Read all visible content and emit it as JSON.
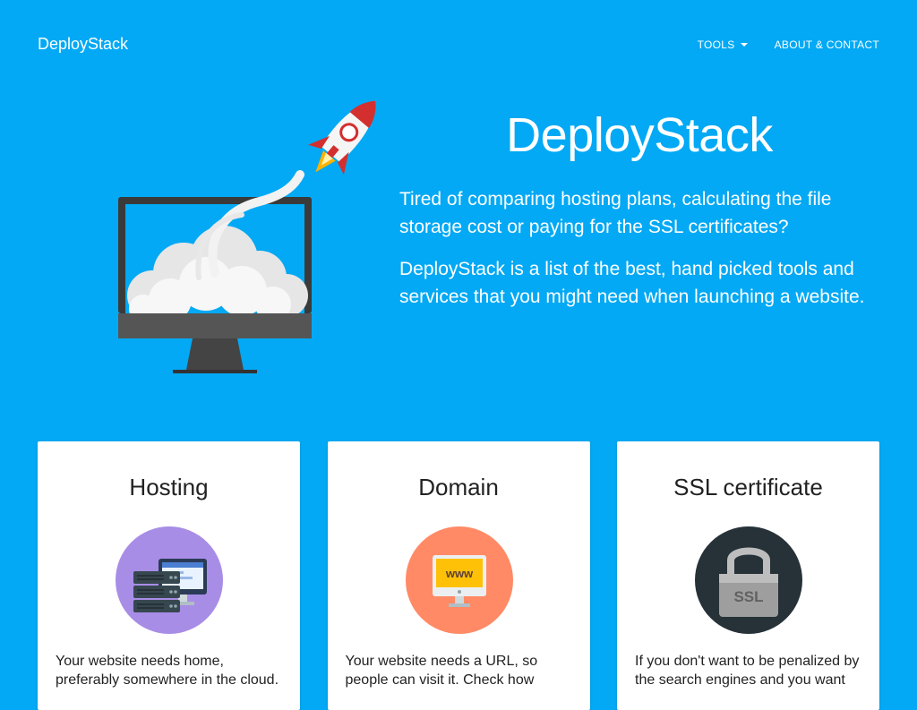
{
  "nav": {
    "brand": "DeployStack",
    "tools": "TOOLS",
    "about": "ABOUT & CONTACT"
  },
  "hero": {
    "title": "DeployStack",
    "p1": "Tired of comparing hosting plans, calculating the file storage cost or paying for the SSL certificates?",
    "p2": "DeployStack is a list of the best, hand picked tools and services that you might need when launching a website."
  },
  "cards": [
    {
      "title": "Hosting",
      "icon": "server-icon",
      "color": "#a88de6",
      "text": "Your website needs home, preferably somewhere in the cloud."
    },
    {
      "title": "Domain",
      "icon": "www-monitor-icon",
      "color": "#ff8a65",
      "text": "Your website needs a URL, so people can visit it. Check how"
    },
    {
      "title": "SSL certificate",
      "icon": "ssl-lock-icon",
      "color": "#263238",
      "text": "If you don't want to be penalized by the search engines and you want"
    }
  ],
  "illustration": {
    "icon": "rocket-monitor-icon"
  },
  "colors": {
    "background": "#03a9f4",
    "card": "#ffffff"
  }
}
